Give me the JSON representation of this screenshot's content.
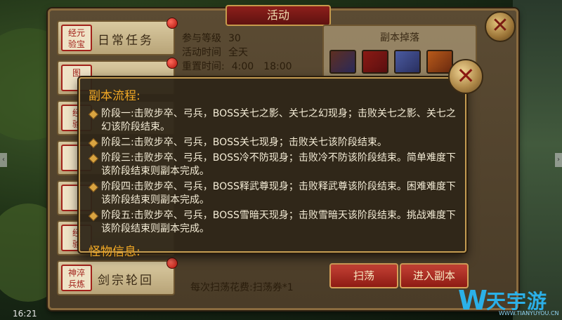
{
  "window": {
    "title": "活动"
  },
  "tabs": [
    {
      "seal": "经元\n验宝",
      "label": "日常任务",
      "badge": true
    },
    {
      "seal": "图",
      "label": "",
      "badge": true
    },
    {
      "seal": "经\n验",
      "label": "",
      "badge": false
    },
    {
      "seal": "",
      "label": "",
      "badge": false
    },
    {
      "seal": "",
      "label": "",
      "badge": false
    },
    {
      "seal": "经\n验",
      "label": "",
      "badge": false
    },
    {
      "seal": "神淬\n兵炼",
      "label": "剑宗轮回",
      "badge": true
    }
  ],
  "info": {
    "level_label": "参与等级",
    "level_value": "30",
    "time_label": "活动时间",
    "time_value": "全天",
    "reset_label": "重置时间:",
    "reset_value": "4:00　18:00"
  },
  "drops": {
    "title": "副本掉落",
    "items": [
      "drop-item-1",
      "drop-item-2",
      "drop-item-3",
      "drop-item-4"
    ]
  },
  "bottom": {
    "cost_text": "每次扫荡花费:扫荡券*1",
    "sweep_label": "扫荡",
    "enter_label": "进入副本"
  },
  "popup": {
    "heading": "副本流程:",
    "stages": [
      "阶段一:击败步卒、弓兵，BOSS关七之影、关七之幻现身；击败关七之影、关七之幻该阶段结束。",
      "阶段二:击败步卒、弓兵，BOSS关七现身；击败关七该阶段结束。",
      "阶段三:击败步卒、弓兵，BOSS冷不防现身；击败冷不防该阶段结束。简单难度下该阶段结束则副本完成。",
      "阶段四:击败步卒、弓兵，BOSS释武尊现身；击败释武尊该阶段结束。困难难度下该阶段结束则副本完成。",
      "阶段五:击败步卒、弓兵，BOSS雪暗天现身；击败雪暗天该阶段结束。挑战难度下该阶段结束则副本完成。"
    ],
    "monster_heading": "怪物信息:"
  },
  "status": {
    "time": "16:21"
  },
  "logo": {
    "name": "天宇游",
    "url": "WWW.TIANYUYOU.CN"
  },
  "colors": {
    "accent_gold": "#f1a825",
    "button_red": "#c54236",
    "popup_bg": "#2e2618"
  }
}
